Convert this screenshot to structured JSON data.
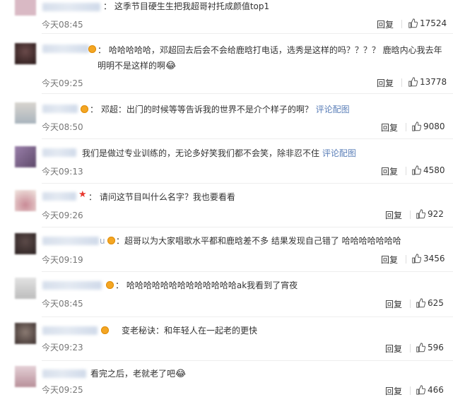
{
  "comments": [
    {
      "name_prefix": "：",
      "text": "这季节目硬生生把我超哥衬托成颜值top1",
      "link": "",
      "time": "今天08:45",
      "reply": "回复",
      "likes": "17524",
      "avatar_color": "#d9b9c4",
      "badge": "none"
    },
    {
      "name_prefix": "：",
      "text": "哈哈哈哈哈，邓超回去后会不会给鹿晗打电话，选秀是这样的吗？？？？ 鹿晗内心我去年\n明明不是这样的啊",
      "link": "",
      "emoji": "😂",
      "time": "今天09:25",
      "reply": "回复",
      "likes": "13778",
      "avatar_color": "#3a2a2a",
      "badge": "coin"
    },
    {
      "name_prefix": "：",
      "text": "邓超：出门的时候等等告诉我的世界不是介个样子的啊？ ",
      "link": "评论配图",
      "time": "今天08:50",
      "reply": "回复",
      "likes": "9080",
      "avatar_color": "#c9c5c0",
      "badge": "coin"
    },
    {
      "name_prefix": "",
      "text": "我们是做过专业训练的，无论多好笑我们都不会笑，除非忍不住 ",
      "link": "评论配图",
      "time": "今天09:13",
      "reply": "回复",
      "likes": "4580",
      "avatar_color": "#8a6f9a",
      "badge": "none"
    },
    {
      "name_prefix": "：",
      "text": "请问这节目叫什么名字？我也要看看",
      "link": "",
      "time": "今天09:26",
      "reply": "回复",
      "likes": "922",
      "avatar_color": "#e8d8d0",
      "badge": "star"
    },
    {
      "name_prefix": "u",
      "text": "超哥以为大家唱歌水平都和鹿晗差不多 结果发现自己错了 哈哈哈哈哈哈哈",
      "link": "",
      "time": "今天09:19",
      "reply": "回复",
      "likes": "3456",
      "avatar_color": "#3b2f2f",
      "badge": "coin"
    },
    {
      "name_prefix": "：",
      "text": "哈哈哈哈哈哈哈哈哈哈哈哈哈ak我看到了宵夜",
      "link": "",
      "time": "今天08:45",
      "reply": "回复",
      "likes": "625",
      "avatar_color": "#d5d5d5",
      "badge": "coin"
    },
    {
      "name_prefix": "：",
      "text": "变老秘诀：和年轻人在一起老的更快",
      "link": "",
      "time": "今天09:23",
      "reply": "回复",
      "likes": "596",
      "avatar_color": "#5a4a44",
      "badge": "coin"
    },
    {
      "name_prefix": "：",
      "text": "看完之后，老就老了吧",
      "link": "",
      "emoji": "😂",
      "time": "今天09:25",
      "reply": "回复",
      "likes": "466",
      "avatar_color": "#c4a0a8",
      "badge": "none"
    }
  ],
  "icons": {
    "like": "thumbs-up-icon",
    "badge": "vip-badge-icon"
  },
  "colors": {
    "link": "#5b7fb8",
    "text": "#333333",
    "time": "#777777"
  }
}
